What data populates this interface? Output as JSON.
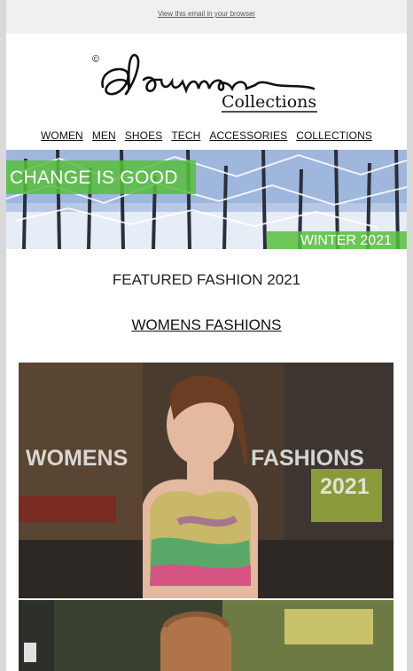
{
  "preheader": {
    "view_in_browser": "View this email in your browser"
  },
  "brand": {
    "script_name": "Baumann",
    "collections": "Collections",
    "copyright": "©"
  },
  "nav": {
    "items": [
      {
        "label": "WOMEN"
      },
      {
        "label": "MEN"
      },
      {
        "label": "SHOES"
      },
      {
        "label": "TECH"
      },
      {
        "label": "ACCESSORIES"
      },
      {
        "label": "COLLECTIONS"
      }
    ]
  },
  "banner": {
    "title": "CHANGE IS GOOD",
    "season": "WINTER 2021"
  },
  "content": {
    "heading": "FEATURED FASHION 2021",
    "womens_link": "WOMENS FASHIONS"
  },
  "photo": {
    "left_text": "WOMENS",
    "right_text": "FASHIONS",
    "year": "2021"
  },
  "colors": {
    "badge_green": "#57be3c",
    "snow_blue": "#a8bfe0",
    "page_gray": "#d9d9d9"
  }
}
